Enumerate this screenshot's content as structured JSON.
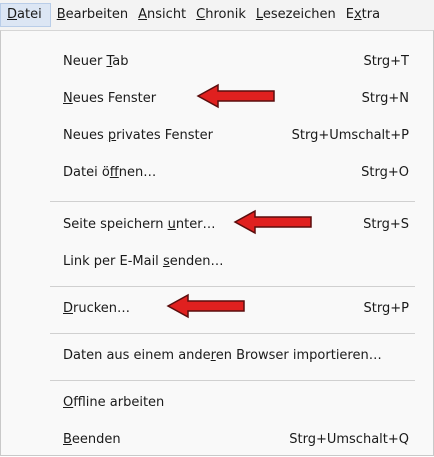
{
  "menubar": {
    "items": [
      {
        "pre": "",
        "acc": "D",
        "post": "atei"
      },
      {
        "pre": "",
        "acc": "B",
        "post": "earbeiten"
      },
      {
        "pre": "",
        "acc": "A",
        "post": "nsicht"
      },
      {
        "pre": "",
        "acc": "C",
        "post": "hronik"
      },
      {
        "pre": "",
        "acc": "L",
        "post": "esezeichen"
      },
      {
        "pre": "E",
        "acc": "x",
        "post": "tra"
      }
    ]
  },
  "file_menu": {
    "items": [
      {
        "pre": "Neuer ",
        "acc": "T",
        "post": "ab",
        "shortcut": "Strg+T"
      },
      {
        "pre": "",
        "acc": "N",
        "post": "eues Fenster",
        "shortcut": "Strg+N"
      },
      {
        "pre": "Neues ",
        "acc": "p",
        "post": "rivates Fenster",
        "shortcut": "Strg+Umschalt+P"
      },
      {
        "pre": "Datei ö",
        "acc": "f",
        "post": "fnen…",
        "shortcut": "Strg+O"
      },
      {
        "pre": "Seite speichern ",
        "acc": "u",
        "post": "nter…",
        "shortcut": "Strg+S"
      },
      {
        "pre": "Link per E-Mail ",
        "acc": "s",
        "post": "enden…",
        "shortcut": ""
      },
      {
        "pre": "",
        "acc": "D",
        "post": "rucken…",
        "shortcut": "Strg+P"
      },
      {
        "pre": "Daten aus einem ande",
        "acc": "r",
        "post": "en Browser importieren…",
        "shortcut": ""
      },
      {
        "pre": "",
        "acc": "O",
        "post": "ffline arbeiten",
        "shortcut": ""
      },
      {
        "pre": "",
        "acc": "B",
        "post": "eenden",
        "shortcut": "Strg+Umschalt+Q"
      }
    ]
  },
  "colors": {
    "arrow_fill": "#e0201f",
    "arrow_stroke": "#5a0d0d",
    "active_menu_bg": "#dce6f4"
  },
  "annotations": {
    "arrow_icon": "left-pointing red arrow",
    "arrow_targets": [
      "Neues Fenster",
      "Seite speichern unter…",
      "Drucken…"
    ]
  }
}
